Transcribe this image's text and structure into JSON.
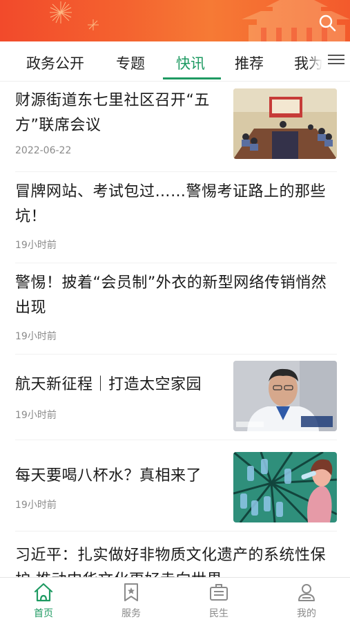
{
  "colors": {
    "accent": "#1e9a62",
    "banner": "#f4622f",
    "muted": "#8a8a8a"
  },
  "header": {
    "search_icon": "search-icon"
  },
  "tabs": [
    {
      "label": "政务公开",
      "active": false
    },
    {
      "label": "专题",
      "active": false
    },
    {
      "label": "快讯",
      "active": true
    },
    {
      "label": "推荐",
      "active": false
    },
    {
      "label": "我为",
      "active": false
    }
  ],
  "menu_icon": "menu-icon",
  "feed": [
    {
      "title": "财源街道东七里社区召开“五方”联席会议",
      "time": "2022-06-22",
      "has_image": true
    },
    {
      "title": "冒牌网站、考试包过……警惕考证路上的那些坑！",
      "time": "19小时前",
      "has_image": false
    },
    {
      "title": "警惕！披着“会员制”外衣的新型网络传销悄然出现",
      "time": "19小时前",
      "has_image": false
    },
    {
      "title": "航天新征程｜打造太空家园",
      "time": "19小时前",
      "has_image": true
    },
    {
      "title": "每天要喝八杯水？真相来了",
      "time": "19小时前",
      "has_image": true
    },
    {
      "title": "习近平：扎实做好非物质文化遗产的系统性保护 推动中华文化更好走向世界",
      "time": "",
      "has_image": false
    }
  ],
  "bottom_nav": [
    {
      "label": "首页",
      "icon": "home-icon",
      "active": true
    },
    {
      "label": "服务",
      "icon": "bookmark-star-icon",
      "active": false
    },
    {
      "label": "民生",
      "icon": "id-card-icon",
      "active": false
    },
    {
      "label": "我的",
      "icon": "user-icon",
      "active": false
    }
  ]
}
